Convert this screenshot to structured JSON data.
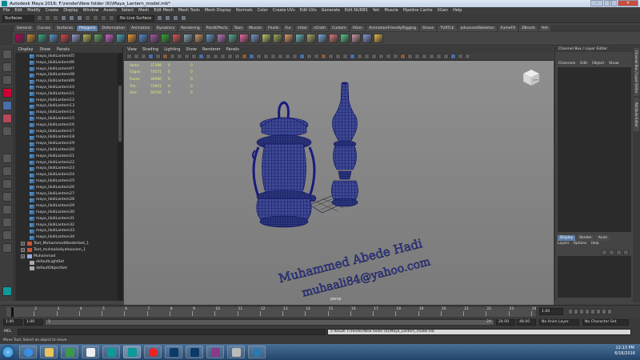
{
  "window": {
    "title": "Autodesk Maya 2016: F:\\render\\New folder (6)\\Maya_Lantern_model.mb*",
    "minimize": "–",
    "maximize": "□",
    "close": "✕"
  },
  "menubar": [
    "File",
    "Edit",
    "Modify",
    "Create",
    "Display",
    "Window",
    "Assets",
    "Select",
    "Mesh",
    "Edit Mesh",
    "Mesh Tools",
    "Mesh Display",
    "Normals",
    "Color",
    "Create UVs",
    "Edit UVs",
    "Generate",
    "Edit NURBS",
    "Yeti",
    "Muscle",
    "Pipeline Cache",
    "XGen",
    "Help"
  ],
  "status_line": {
    "mode": "Surfaces",
    "live_surface": "No Live Surface"
  },
  "shelf_tabs": [
    "General",
    "Curves",
    "Surfaces",
    "Polygons",
    "Deformation",
    "Animation",
    "Dynamics",
    "Rendering",
    "PaintEffects",
    "Toon",
    "Muscle",
    "Fluids",
    "Fur",
    "nHair",
    "nCloth",
    "Custom",
    "XGen",
    "AnimationFriendlyRigging",
    "Shave",
    "TURTLE",
    "advancedSkeleton",
    "FumeFX",
    "ZBrush",
    "Yeti"
  ],
  "active_shelf_tab": "Polygons",
  "outliner": {
    "menu": [
      "Display",
      "Show",
      "Panels"
    ],
    "items": [
      {
        "icon": "mesh",
        "label": "maya_likdiLantern05"
      },
      {
        "icon": "mesh",
        "label": "maya_likdiLantern06"
      },
      {
        "icon": "mesh",
        "label": "maya_likdiLantern07"
      },
      {
        "icon": "mesh",
        "label": "maya_likdiLantern08"
      },
      {
        "icon": "mesh",
        "label": "maya_likdiLantern09"
      },
      {
        "icon": "mesh",
        "label": "maya_likdiLantern10"
      },
      {
        "icon": "mesh",
        "label": "maya_likdiLantern11"
      },
      {
        "icon": "mesh",
        "label": "maya_likdiLantern12"
      },
      {
        "icon": "mesh",
        "label": "maya_likdiLantern13"
      },
      {
        "icon": "mesh",
        "label": "maya_likdiLantern14"
      },
      {
        "icon": "mesh",
        "label": "maya_likdiLantern15"
      },
      {
        "icon": "mesh",
        "label": "maya_likdiLantern16"
      },
      {
        "icon": "mesh",
        "label": "maya_likdiLantern17"
      },
      {
        "icon": "mesh",
        "label": "maya_likdiLantern18"
      },
      {
        "icon": "mesh",
        "label": "maya_likdiLantern19"
      },
      {
        "icon": "mesh",
        "label": "maya_likdiLantern20"
      },
      {
        "icon": "mesh",
        "label": "maya_likdiLantern21"
      },
      {
        "icon": "mesh",
        "label": "maya_likdiLantern22"
      },
      {
        "icon": "mesh",
        "label": "maya_likdiLantern23"
      },
      {
        "icon": "mesh",
        "label": "maya_likdiLantern24"
      },
      {
        "icon": "mesh",
        "label": "maya_likdiLantern25"
      },
      {
        "icon": "mesh",
        "label": "maya_likdiLantern26"
      },
      {
        "icon": "mesh",
        "label": "maya_likdiLantern27"
      },
      {
        "icon": "mesh",
        "label": "maya_likdiLantern28"
      },
      {
        "icon": "mesh",
        "label": "maya_likdiLantern29"
      },
      {
        "icon": "mesh",
        "label": "maya_likdiLantern30"
      },
      {
        "icon": "mesh",
        "label": "maya_likdiLantern31"
      },
      {
        "icon": "mesh",
        "label": "maya_likdiLantern32"
      },
      {
        "icon": "mesh",
        "label": "maya_likdiLantern33"
      },
      {
        "icon": "mesh",
        "label": "maya_likdiLantern34"
      },
      {
        "icon": "txt",
        "label": "Text_MuhammedAbedeHadi_1",
        "expand": "+"
      },
      {
        "icon": "txt",
        "label": "Text_muhaalio4yahoocom_1",
        "expand": "+"
      },
      {
        "icon": "curve",
        "label": "Muhammad",
        "expand": "+"
      },
      {
        "icon": "set",
        "label": "defaultLightSet"
      },
      {
        "icon": "set",
        "label": "defaultObjectSet"
      }
    ]
  },
  "viewport": {
    "menu": [
      "View",
      "Shading",
      "Lighting",
      "Show",
      "Renderer",
      "Panels"
    ],
    "camera": "persp",
    "viewcube_label": "LEFT",
    "hud": [
      {
        "label": "Verts:",
        "v1": "37396",
        "v2": "0",
        "v3": "0"
      },
      {
        "label": "Edges:",
        "v1": "74571",
        "v2": "0",
        "v3": "0"
      },
      {
        "label": "Faces:",
        "v1": "38086",
        "v2": "0",
        "v3": "0"
      },
      {
        "label": "Tris:",
        "v1": "73951",
        "v2": "0",
        "v3": "0"
      },
      {
        "label": "UVs:",
        "v1": "59720",
        "v2": "0",
        "v3": "0"
      }
    ],
    "scene_text_1": "Muhammed Abede Hadi",
    "scene_text_2": "muhaali84@yahoo.com"
  },
  "channel_box": {
    "title": "Channel Box / Layer Editor",
    "menu": [
      "Channels",
      "Edit",
      "Object",
      "Show"
    ],
    "layer_tabs": [
      "Display",
      "Render",
      "Anim"
    ],
    "active_layer_tab": "Display",
    "layer_menu": [
      "Layers",
      "Options",
      "Help"
    ]
  },
  "side_tabs": [
    "Channel Box / Layer Editor",
    "Attribute Editor"
  ],
  "time_slider": {
    "ticks": [
      "1",
      "2",
      "3",
      "4",
      "5",
      "6",
      "7",
      "8",
      "9",
      "10",
      "11",
      "12",
      "13",
      "14",
      "15",
      "16",
      "17",
      "18",
      "19",
      "20",
      "21",
      "22",
      "23",
      "24"
    ],
    "current_frame": "1.00"
  },
  "range_slider": {
    "start": "1.00",
    "inner_start": "1.00",
    "inner_start_label": "1",
    "inner_end_label": "24",
    "end": "24.00",
    "out_end": "48.00",
    "anim_layer": "No Anim Layer",
    "char_set": "No Character Set"
  },
  "command_line": {
    "label": "MEL",
    "result": "// Result: F:/render/New folder (6)/Maya_Lantern_model.mb"
  },
  "help_line": "Move Tool: Select an object to move.",
  "taskbar": {
    "time": "12:13 PM",
    "date": "6/16/2016"
  },
  "colors": {
    "mesh_wire": "#1a1a8c",
    "viewport_bg": "#8a8a8a",
    "hud_text": "#d9f07a",
    "accent": "#5f7fa8"
  }
}
